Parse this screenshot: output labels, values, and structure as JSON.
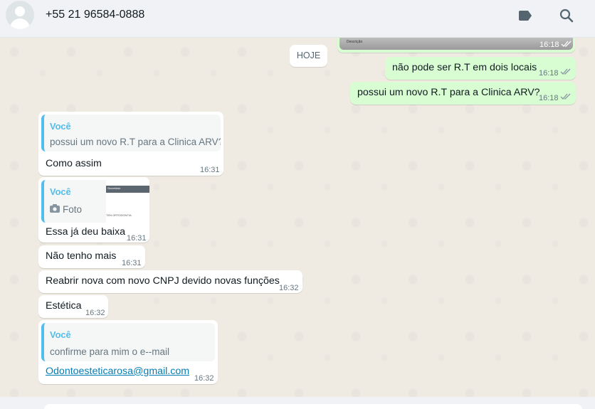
{
  "header": {
    "contact": "+55 21 96584-0888",
    "icons": [
      "label-icon",
      "search-icon"
    ]
  },
  "date_divider": "HOJE",
  "image_message": {
    "time": "16:18",
    "caption_fragment": "Descrição"
  },
  "outgoing": [
    {
      "text": "não pode ser R.T em dois locais",
      "time": "16:18",
      "status": "read"
    },
    {
      "text": "possui um novo R.T para a Clinica ARV?",
      "time": "16:18",
      "status": "read"
    }
  ],
  "incoming": [
    {
      "quote_author": "Você",
      "quote_text": "possui um novo R.T para a Clinica ARV?",
      "text": "Como assim",
      "time": "16:31"
    },
    {
      "quote_author": "Você",
      "quote_text": "Foto",
      "quote_thumb_header": "Secretário",
      "quote_thumb_line": "TEN ORTODONTIA",
      "text": "Essa já deu baixa",
      "time": "16:31"
    },
    {
      "text": "Não tenho mais",
      "time": "16:31"
    },
    {
      "text": "Reabrir nova com novo CNPJ devido novas funções",
      "time": "16:32"
    },
    {
      "text": "Estética",
      "time": "16:32"
    },
    {
      "quote_author": "Você",
      "quote_text": "confirme para mim o e--mail",
      "text": "Odontoesteticarosa@gmail.com",
      "time": "16:32",
      "is_link": true
    }
  ],
  "colors": {
    "incoming_bubble": "#ffffff",
    "outgoing_bubble": "#d9fdd3",
    "quote_accent": "#53bdeb",
    "link": "#027eb5",
    "chat_background": "#efeae2"
  }
}
